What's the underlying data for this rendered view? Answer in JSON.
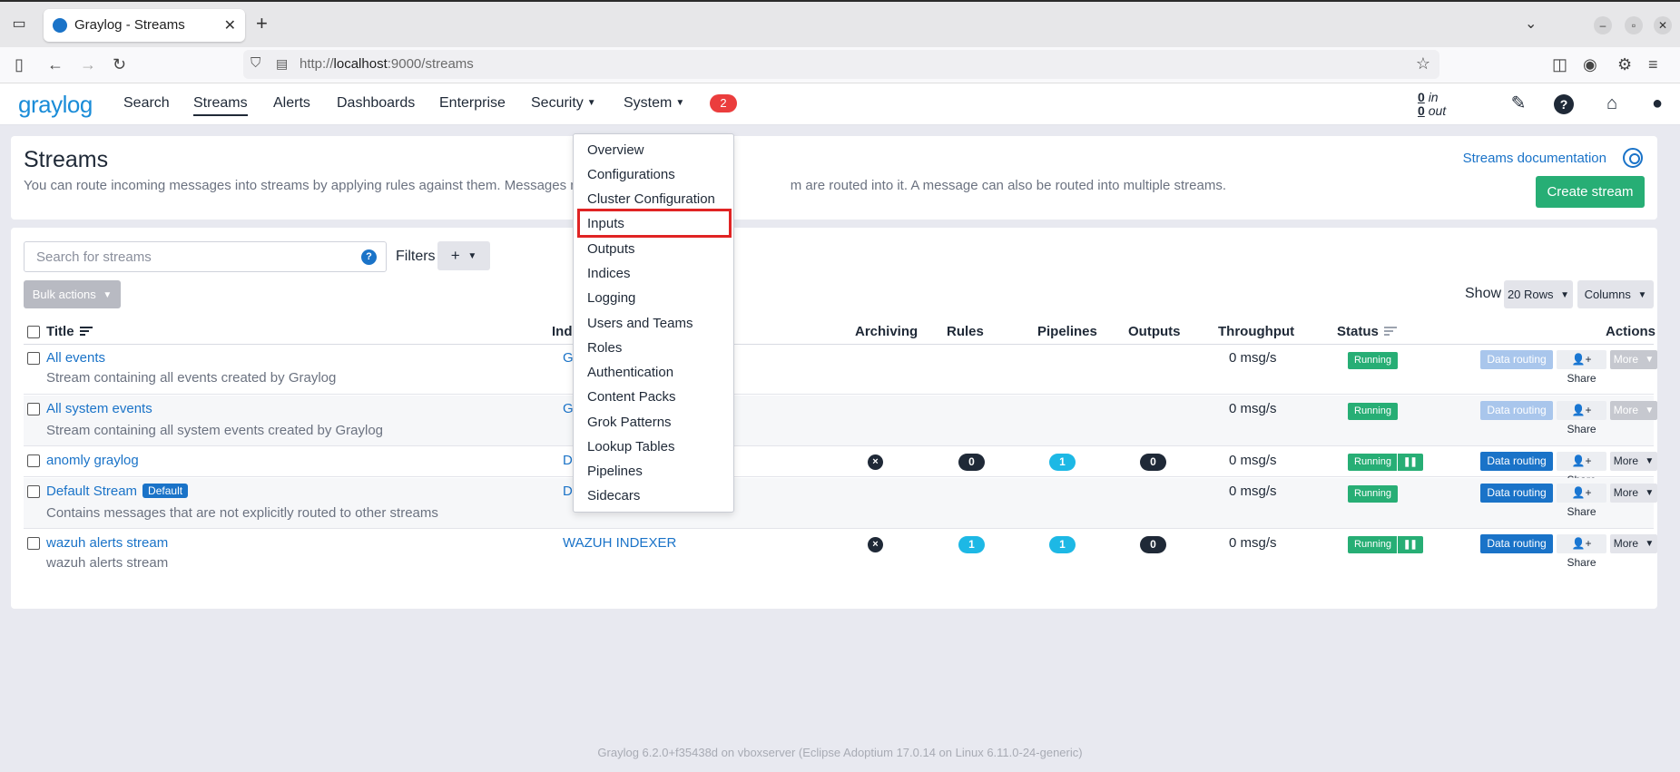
{
  "browser": {
    "tab_title": "Graylog - Streams",
    "url_scheme": "http://",
    "url_host": "localhost",
    "url_rest": ":9000/streams"
  },
  "nav": {
    "logo": "graylog",
    "items": [
      "Search",
      "Streams",
      "Alerts",
      "Dashboards",
      "Enterprise",
      "Security",
      "System"
    ],
    "notifications": "2",
    "throughput_in": "0",
    "throughput_in_label": "in",
    "throughput_out": "0",
    "throughput_out_label": "out"
  },
  "header": {
    "title": "Streams",
    "description": "You can route incoming messages into streams by applying rules against them. Messages m",
    "description_tail": "m are routed into it. A message can also be routed into multiple streams.",
    "docs_link": "Streams documentation",
    "create_button": "Create stream"
  },
  "toolbar": {
    "search_placeholder": "Search for streams",
    "search_help": "?",
    "filters_label": "Filters",
    "filters_button": "+",
    "bulk_actions": "Bulk actions",
    "show_label": "Show",
    "rows_button": "20 Rows",
    "columns_button": "Columns"
  },
  "table": {
    "columns": {
      "title": "Title",
      "index": "Ind",
      "archiving": "Archiving",
      "rules": "Rules",
      "pipelines": "Pipelines",
      "outputs": "Outputs",
      "throughput": "Throughput",
      "status": "Status",
      "actions": "Actions"
    },
    "rows": [
      {
        "title": "All events",
        "description": "Stream containing all events created by Graylog",
        "index": "Gra",
        "throughput": "0 msg/s",
        "status": "Running",
        "route": "Data routing",
        "share": "Share",
        "more": "More"
      },
      {
        "title": "All system events",
        "description": "Stream containing all system events created by Graylog",
        "index": "Gra",
        "throughput": "0 msg/s",
        "status": "Running",
        "route": "Data routing",
        "share": "Share",
        "more": "More"
      },
      {
        "title": "anomly graylog",
        "description": "",
        "index": "Def",
        "archiving": "×",
        "rules": "0",
        "pipelines": "1",
        "outputs": "0",
        "throughput": "0 msg/s",
        "status": "Running",
        "route": "Data routing",
        "share": "Share",
        "more": "More"
      },
      {
        "title": "Default Stream",
        "badge": "Default",
        "description": "Contains messages that are not explicitly routed to other streams",
        "index": "Def",
        "throughput": "0 msg/s",
        "status": "Running",
        "route": "Data routing",
        "share": "Share",
        "more": "More"
      },
      {
        "title": "wazuh alerts stream",
        "description": "wazuh alerts stream",
        "index": "WAZUH INDEXER",
        "archiving": "×",
        "rules": "1",
        "pipelines": "1",
        "outputs": "0",
        "throughput": "0 msg/s",
        "status": "Running",
        "route": "Data routing",
        "share": "Share",
        "more": "More"
      }
    ]
  },
  "system_menu": {
    "items": [
      "Overview",
      "Configurations",
      "Cluster Configuration",
      "Inputs",
      "Outputs",
      "Indices",
      "Logging",
      "Users and Teams",
      "Roles",
      "Authentication",
      "Content Packs",
      "Grok Patterns",
      "Lookup Tables",
      "Pipelines",
      "Sidecars"
    ],
    "highlighted": "Inputs"
  },
  "footer": "Graylog 6.2.0+f35438d on vboxserver (Eclipse Adoptium 17.0.14 on Linux 6.11.0-24-generic)",
  "colors": {
    "accent": "#1a73c8",
    "success": "#27ae75",
    "danger": "#eb3d3d"
  }
}
